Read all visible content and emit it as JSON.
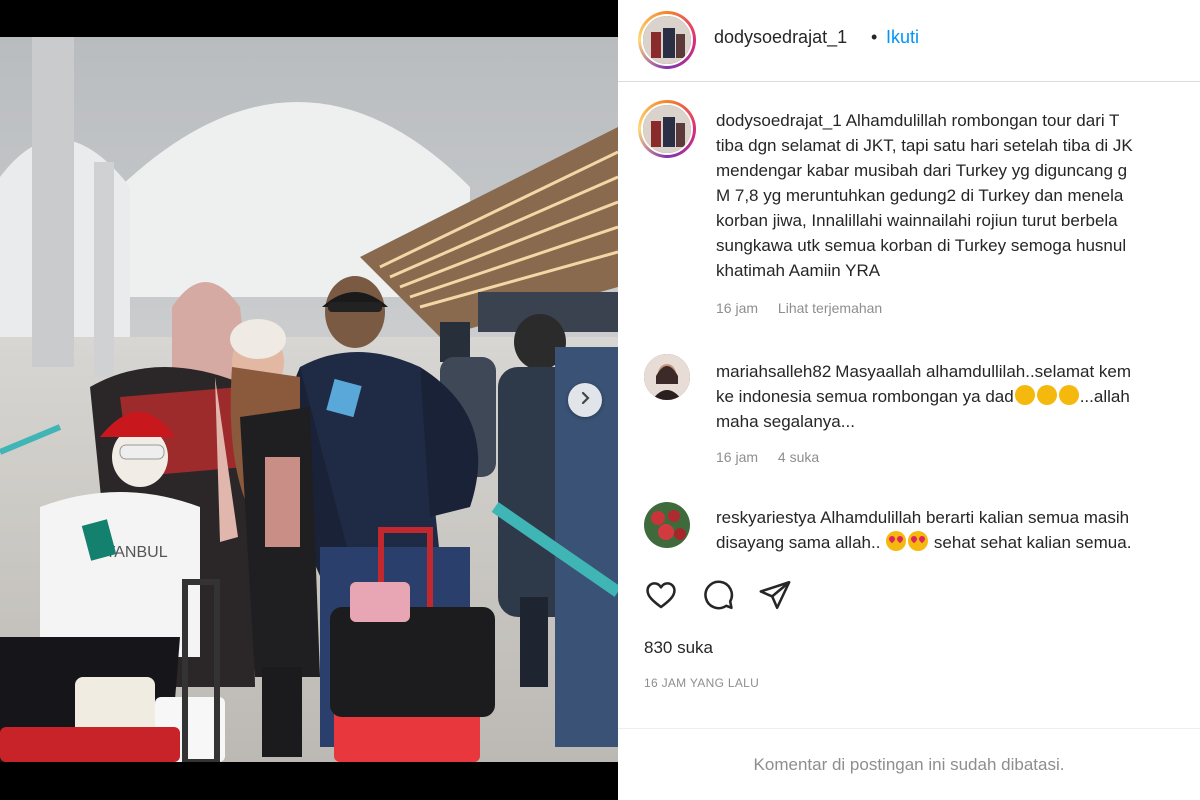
{
  "header": {
    "username": "dodysoedrajat_1",
    "separator": "•",
    "follow_label": "Ikuti"
  },
  "caption": {
    "username": "dodysoedrajat_1",
    "lines": [
      "Alhamdulillah rombongan tour dari T",
      "tiba dgn selamat di JKT, tapi satu hari setelah tiba di JK",
      "mendengar kabar musibah dari Turkey yg diguncang g",
      "M 7,8 yg meruntuhkan gedung2 di Turkey dan menela",
      "korban jiwa, Innalillahi wainnailahi rojiun turut berbela",
      "sungkawa utk semua korban di Turkey semoga husnul",
      "khatimah Aamiin YRA"
    ],
    "time": "16 jam",
    "translate_label": "Lihat terjemahan"
  },
  "comments": [
    {
      "username": "mariahsalleh82",
      "lines": [
        "Masyaallah alhamdullilah..selamat kem",
        "ke indonesia semua rombongan ya dad",
        "...allah",
        "maha segalanya..."
      ],
      "time": "16 jam",
      "likes": "4 suka"
    },
    {
      "username": "reskyariestya",
      "lines": [
        "Alhamdulillah berarti kalian semua masih",
        "disayang sama allah..",
        "sehat sehat kalian semua."
      ]
    }
  ],
  "likes_count": "830 suka",
  "timestamp": "16 JAM YANG LALU",
  "comments_limited": "Komentar di postingan ini sudah dibatasi.",
  "icons": {
    "like": "heart-icon",
    "comment": "comment-bubble-icon",
    "share": "paper-plane-icon",
    "carousel": "chevron-right-icon"
  },
  "colors": {
    "link_blue": "#0095f6",
    "text": "#262626",
    "muted": "#8e8e8e"
  }
}
